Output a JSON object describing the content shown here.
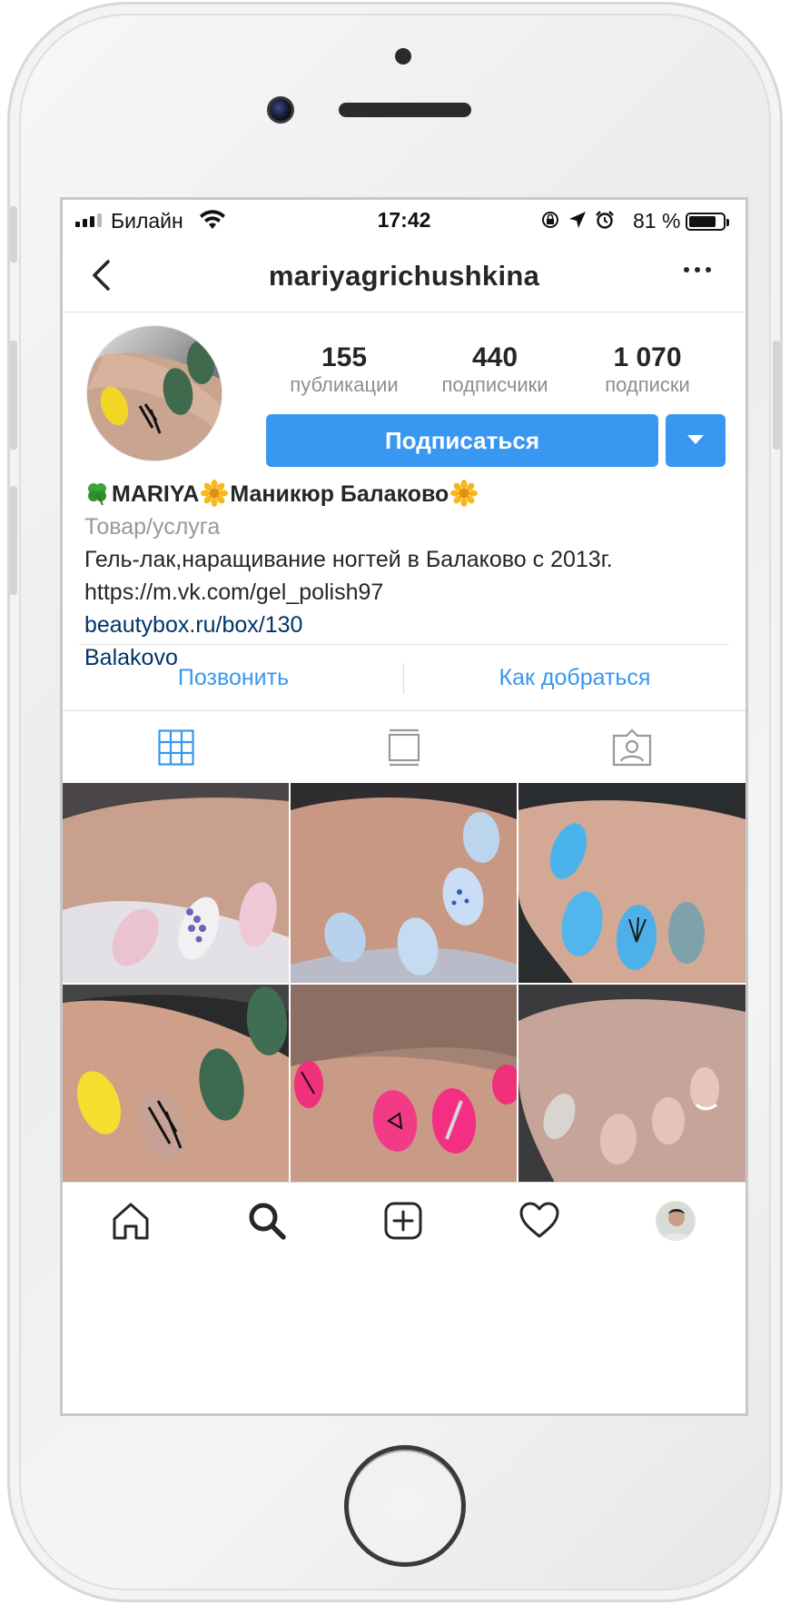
{
  "status_bar": {
    "carrier": "Билайн",
    "time": "17:42",
    "battery_percent": "81 %",
    "battery_level": 0.81
  },
  "header": {
    "username": "mariyagrichushkina"
  },
  "profile": {
    "stats": [
      {
        "value": "155",
        "label": "публикации"
      },
      {
        "value": "440",
        "label": "подписчики"
      },
      {
        "value": "1 070",
        "label": "подписки"
      }
    ],
    "follow_label": "Подписаться",
    "name_part1": "MARIYA",
    "name_part2": "Маникюр Балаково",
    "category": "Товар/услуга",
    "bio_line1": "Гель-лак,наращивание ногтей в Балаково с 2013г.",
    "bio_line2": "https://m.vk.com/gel_polish97",
    "website": "beautybox.ru/box/130",
    "location": "Balakovo"
  },
  "contact_actions": {
    "call": "Позвонить",
    "directions": "Как добраться"
  },
  "view_tabs": [
    "grid-icon",
    "feed-icon",
    "tagged-icon"
  ],
  "posts_count_visible": 6,
  "colors": {
    "accent": "#3897f0",
    "link": "#003569",
    "secondary_text": "#8e8e8e"
  },
  "tab_bar": [
    "home-icon",
    "search-icon",
    "new-post-icon",
    "activity-icon",
    "profile-avatar"
  ]
}
